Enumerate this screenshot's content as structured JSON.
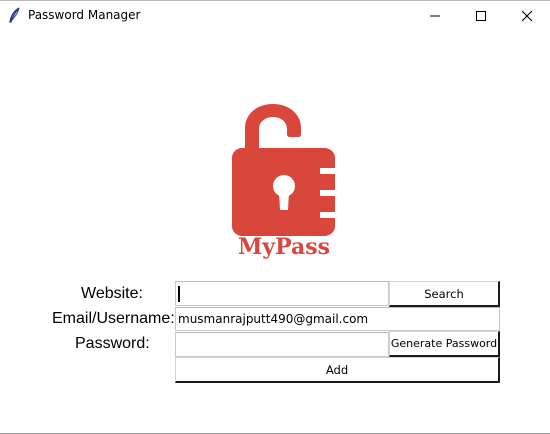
{
  "window": {
    "title": "Password Manager",
    "icon": "feather-icon",
    "controls": {
      "minimize_icon": "minimize-icon",
      "maximize_icon": "maximize-icon",
      "close_icon": "close-icon"
    }
  },
  "logo": {
    "text": "MyPass",
    "icon": "unlocked-padlock-icon",
    "color": "#d9473c"
  },
  "form": {
    "website": {
      "label": "Website:",
      "value": ""
    },
    "email": {
      "label": "Email/Username:",
      "value": "musmanrajputt490@gmail.com"
    },
    "password": {
      "label": "Password:",
      "value": ""
    },
    "buttons": {
      "search": "Search",
      "generate": "Generate Password",
      "add": "Add"
    }
  }
}
